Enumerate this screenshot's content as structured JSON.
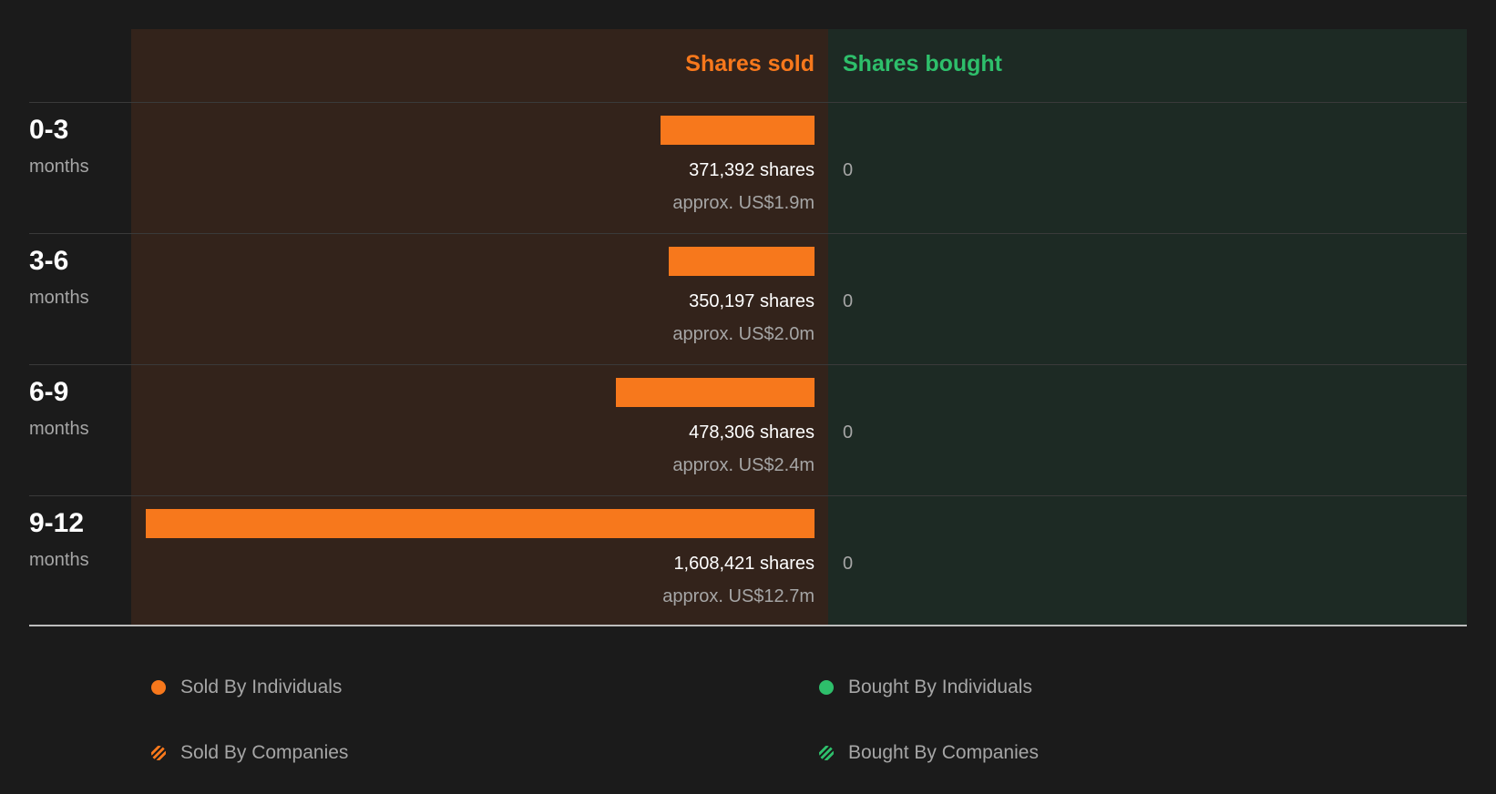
{
  "chart_data": {
    "type": "bar",
    "headers": {
      "sold": "Shares sold",
      "bought": "Shares bought"
    },
    "categories": [
      {
        "period": "0-3",
        "unit": "months"
      },
      {
        "period": "3-6",
        "unit": "months"
      },
      {
        "period": "6-9",
        "unit": "months"
      },
      {
        "period": "9-12",
        "unit": "months"
      }
    ],
    "series": [
      {
        "name": "Shares sold",
        "values": [
          371392,
          350197,
          478306,
          1608421
        ],
        "labels": [
          "371,392 shares",
          "350,197 shares",
          "478,306 shares",
          "1,608,421 shares"
        ],
        "approx": [
          "approx. US$1.9m",
          "approx. US$2.0m",
          "approx. US$2.4m",
          "approx. US$12.7m"
        ]
      },
      {
        "name": "Shares bought",
        "values": [
          0,
          0,
          0,
          0
        ],
        "labels": [
          "0",
          "0",
          "0",
          "0"
        ]
      }
    ],
    "legend": {
      "sold_individuals": "Sold By Individuals",
      "sold_companies": "Sold By Companies",
      "bought_individuals": "Bought By Individuals",
      "bought_companies": "Bought By Companies"
    },
    "colors": {
      "sold": "#f7781c",
      "bought": "#2ebf6b",
      "sold_bg": "#33231b",
      "bought_bg": "#1d2a24",
      "background": "#1b1b1b"
    }
  }
}
